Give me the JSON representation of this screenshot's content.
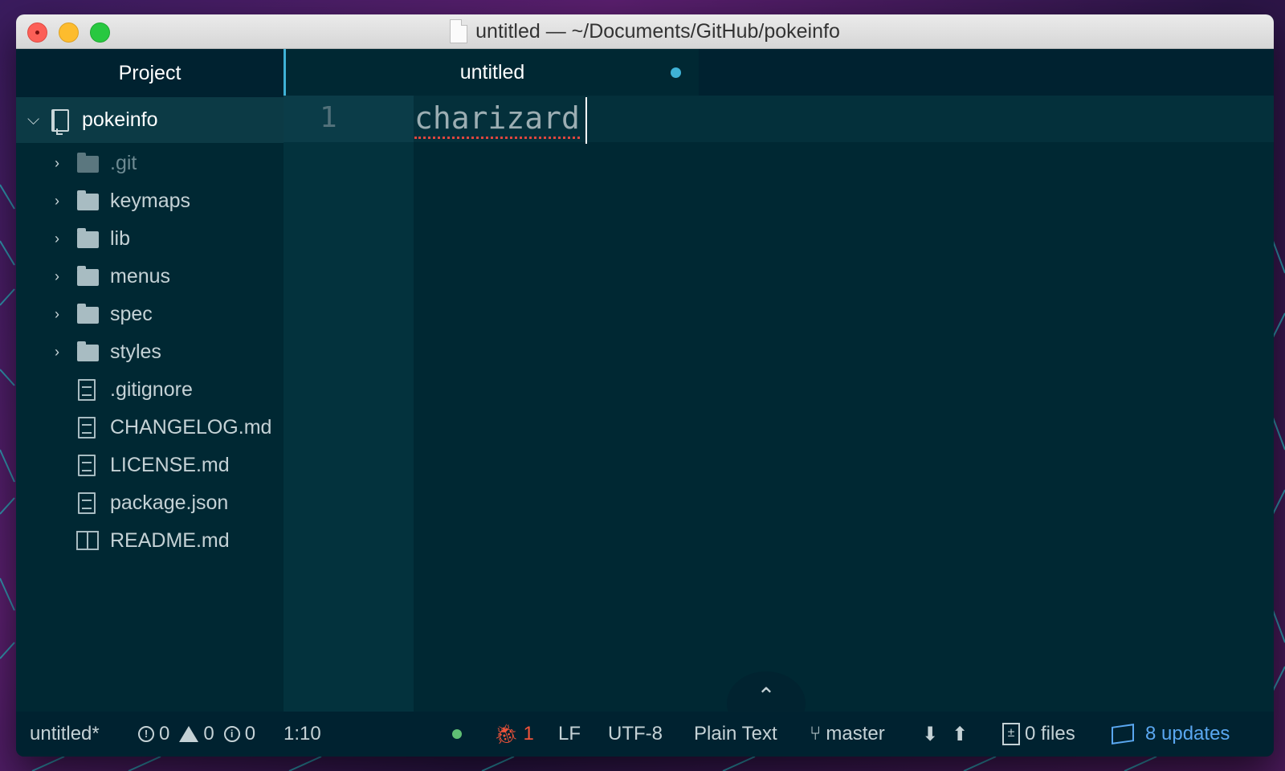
{
  "window": {
    "title": "untitled — ~/Documents/GitHub/pokeinfo"
  },
  "sidebar": {
    "header": "Project",
    "root": "pokeinfo",
    "items": [
      {
        "label": ".git",
        "type": "folder",
        "dim": true
      },
      {
        "label": "keymaps",
        "type": "folder"
      },
      {
        "label": "lib",
        "type": "folder"
      },
      {
        "label": "menus",
        "type": "folder"
      },
      {
        "label": "spec",
        "type": "folder"
      },
      {
        "label": "styles",
        "type": "folder"
      },
      {
        "label": ".gitignore",
        "type": "file"
      },
      {
        "label": "CHANGELOG.md",
        "type": "file"
      },
      {
        "label": "LICENSE.md",
        "type": "file"
      },
      {
        "label": "package.json",
        "type": "file"
      },
      {
        "label": "README.md",
        "type": "book"
      }
    ]
  },
  "tabs": [
    {
      "label": "untitled",
      "modified": true
    }
  ],
  "editor": {
    "line_number": "1",
    "text": "charizard"
  },
  "statusbar": {
    "file": "untitled*",
    "errors": "0",
    "warnings": "0",
    "infos": "0",
    "cursor": "1:10",
    "bug_count": "1",
    "line_ending": "LF",
    "encoding": "UTF-8",
    "grammar": "Plain Text",
    "branch": "master",
    "files": "0 files",
    "updates": "8 updates"
  },
  "colors": {
    "accent": "#3fb2d6",
    "error": "#f0533a",
    "updates": "#5aa7f0",
    "background": "#002833"
  }
}
